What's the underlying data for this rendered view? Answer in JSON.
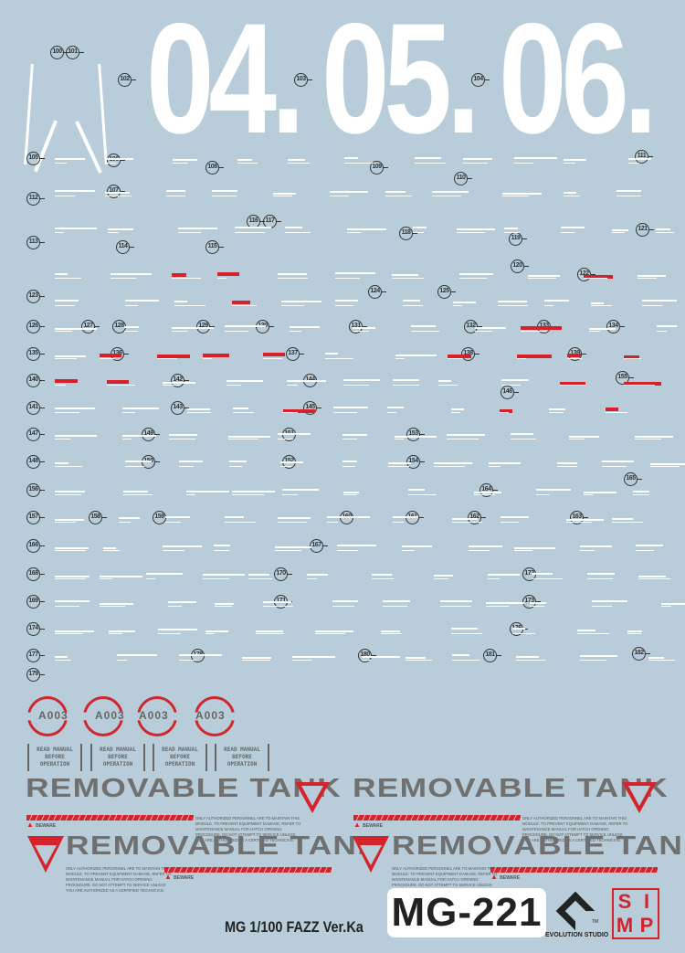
{
  "sheet": {
    "big_numbers": [
      "04.",
      "05.",
      "06."
    ],
    "markers": [
      "100",
      "101",
      "102",
      "103",
      "104",
      "105",
      "106",
      "107",
      "108",
      "109",
      "110",
      "111",
      "112",
      "113",
      "114",
      "115",
      "116",
      "117",
      "118",
      "119",
      "120",
      "121",
      "122",
      "123",
      "124",
      "125",
      "126",
      "127",
      "128",
      "129",
      "130",
      "131",
      "132",
      "133",
      "134",
      "135",
      "136",
      "137",
      "138",
      "139",
      "140",
      "141",
      "142",
      "143",
      "144",
      "145",
      "146",
      "147",
      "148",
      "149",
      "150",
      "151",
      "152",
      "153",
      "154",
      "155",
      "156",
      "157",
      "158",
      "159",
      "160",
      "161",
      "162",
      "163",
      "164",
      "165",
      "166",
      "167",
      "168",
      "169",
      "170",
      "171",
      "172",
      "173",
      "174",
      "176",
      "177",
      "178",
      "179",
      "180",
      "181",
      "182"
    ],
    "a003": [
      "A003",
      "A003",
      "A003",
      "A003"
    ],
    "read_manual": {
      "line1": "READ MANUAL",
      "line2": "BEFORE",
      "line3": "OPERATION"
    },
    "tank_title": "REMOVABLE TANK",
    "beware": "BEWARE",
    "warning_text": "ONLY AUTHORIZED PERSONNEL ARE TO MAINTAIN THIS MODULE. TO PREVENT EQUIPMENT DAMAGE, REFER TO MAINTENANCE MANUAL FOR HATCH OPENING PROCEDURE. DO NOT ATTEMPT TO SERVICE UNLESS YOU ARE AUTHORIZED AS A CERTIFIED TECHNICIAN.",
    "product_name": "MG 1/100 FAZZ Ver.Ka",
    "code": "MG-221",
    "brand": "EVOLUTION STUDIO",
    "brand_tm": "TM",
    "simp_logo": "SIMP",
    "colors": {
      "background": "#b8cdd9",
      "red": "#d4232b",
      "gray": "#707070"
    }
  }
}
